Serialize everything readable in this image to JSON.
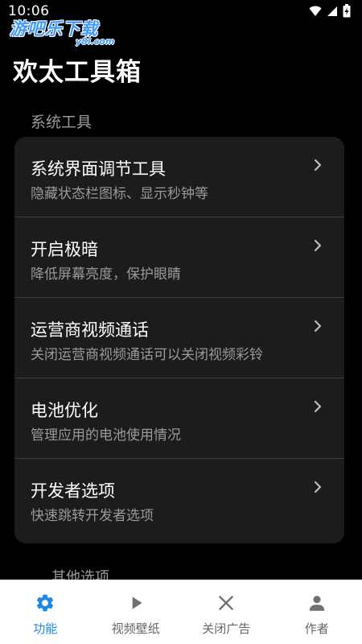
{
  "status_bar": {
    "time": "10:06",
    "wifi_icon": "wifi-icon",
    "signal_icon": "signal-icon",
    "battery_icon": "battery-charging-icon"
  },
  "watermark": {
    "main": "游吧乐下载",
    "sub": "y8l.com"
  },
  "app": {
    "title": "欢太工具箱"
  },
  "sections": [
    {
      "label": "系统工具",
      "items": [
        {
          "title": "系统界面调节工具",
          "subtitle": "隐藏状态栏图标、显示秒钟等"
        },
        {
          "title": "开启极暗",
          "subtitle": "降低屏幕亮度，保护眼睛"
        },
        {
          "title": "运营商视频通话",
          "subtitle": "关闭运营商视频通话可以关闭视频彩铃"
        },
        {
          "title": "电池优化",
          "subtitle": "管理应用的电池使用情况"
        },
        {
          "title": "开发者选项",
          "subtitle": "快速跳转开发者选项"
        }
      ]
    },
    {
      "label": "其他选项"
    }
  ],
  "bottom_nav": [
    {
      "label": "功能",
      "icon": "gear-icon",
      "active": true
    },
    {
      "label": "视频壁纸",
      "icon": "play-icon",
      "active": false
    },
    {
      "label": "关闭广告",
      "icon": "close-icon",
      "active": false
    },
    {
      "label": "作者",
      "icon": "person-icon",
      "active": false
    }
  ],
  "colors": {
    "background": "#000000",
    "card": "#1c1c1e",
    "divider": "#3a3a3c",
    "primary_text": "#ffffff",
    "secondary_text": "#9a9a9a",
    "accent": "#1e88e5",
    "nav_inactive": "#666666",
    "nav_background": "#ffffff"
  }
}
